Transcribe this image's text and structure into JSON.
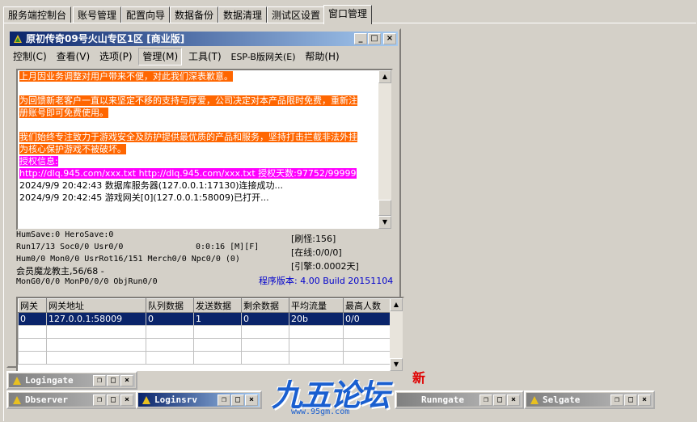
{
  "tabs": [
    "服务端控制台",
    "账号管理",
    "配置向导",
    "数据备份",
    "数据清理",
    "测试区设置",
    "窗口管理"
  ],
  "window": {
    "title": "原初传奇09号火山专区1区 [商业版]",
    "menu": [
      "控制(C)",
      "查看(V)",
      "选项(P)",
      "管理(M)",
      "工具(T)",
      "ESP-B版网关(E)",
      "帮助(H)"
    ],
    "log": [
      {
        "text": "上月因业务调整对用户带来不便，对此我们深表歉意。",
        "style": "orange"
      },
      {
        "text": "",
        "style": ""
      },
      {
        "text": "为回馈新老客户一直以来坚定不移的支持与厚爱，公司决定对本产品限时免费，重新注",
        "style": "orange"
      },
      {
        "text": "册账号即可免费使用。",
        "style": "orange"
      },
      {
        "text": "",
        "style": ""
      },
      {
        "text": "我们始终专注致力于游戏安全及防护提供最优质的产品和服务，坚持打击拦截非法外挂",
        "style": "orange"
      },
      {
        "text": "为核心保护游戏不被破坏。",
        "style": "orange"
      },
      {
        "text": "授权信息:",
        "style": "magenta"
      },
      {
        "text": "http://dlq.945.com/xxx.txt http://dlq.945.com/xxx.txt 授权天数:97752/99999",
        "style": "magenta"
      },
      {
        "text": "2024/9/9 20:42:43 数据库服务器(127.0.0.1:17130)连接成功...",
        "style": ""
      },
      {
        "text": "2024/9/9 20:42:45 游戏网关[0](127.0.0.1:58009)已打开...",
        "style": ""
      }
    ],
    "stats": {
      "line1": "HumSave:0 HeroSave:0",
      "line2": "Run17/13 Soc0/0 Usr0/0",
      "time": "0:0:16 [M][F]",
      "line3": "Hum0/0 Mon0/0 UsrRot16/151 Merch0/0 Npc0/0 (0)",
      "line4": "会员魔龙教主,56/68 -",
      "line5": "MonG0/0/0 MonP0/0/0 ObjRun0/0",
      "refresh": "[刷怪:156]",
      "online": "[在线:0/0/0]",
      "engine": "[引擎:0.0002天]",
      "version": "程序版本: 4.00 Build 20151104"
    },
    "grid": {
      "headers": [
        "网关",
        "网关地址",
        "队列数据",
        "发送数据",
        "剩余数据",
        "平均流量",
        "最高人数"
      ],
      "rows": [
        [
          "0",
          "127.0.0.1:58009",
          "0",
          "1",
          "0",
          "20b",
          "0/0"
        ]
      ]
    }
  },
  "mini_windows": [
    "Logingate",
    "Dbserver",
    "Loginsrv",
    "Runngate",
    "Selgate"
  ],
  "logo": {
    "text": "九五论坛",
    "url": "www.95gm.com",
    "badge": "新"
  },
  "colors": {
    "orange": "#ff6600",
    "magenta": "#ff00ff",
    "title_active": "#0a246a",
    "version_text": "#0000cc"
  }
}
